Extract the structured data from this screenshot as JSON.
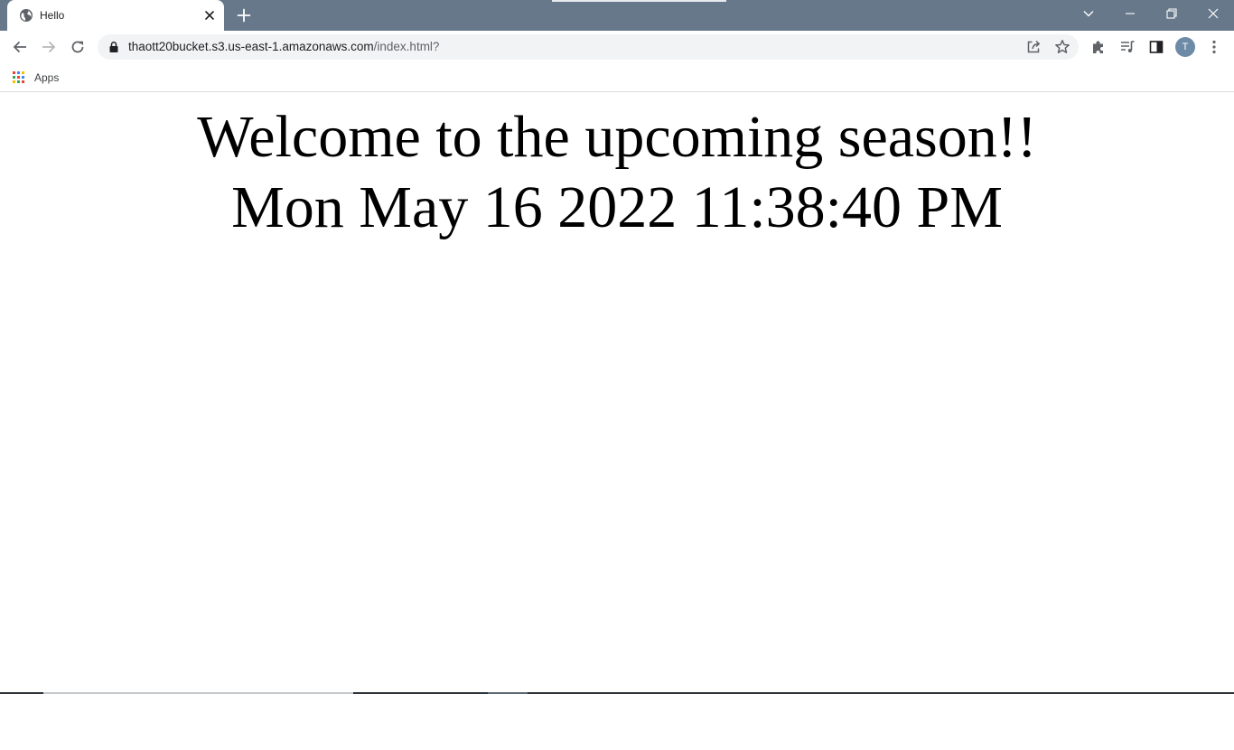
{
  "tab": {
    "title": "Hello",
    "favicon": "globe-icon",
    "close_icon": "close-icon"
  },
  "tabstrip": {
    "new_tab_icon": "plus-icon",
    "search_tabs_icon": "chevron-down-icon",
    "minimize_icon": "minimize-icon",
    "restore_icon": "restore-icon",
    "close_window_icon": "close-icon"
  },
  "toolbar": {
    "url_host": "thaott20bucket.s3.us-east-1.amazonaws.com",
    "url_path": "/index.html?",
    "lock_icon": "lock-icon",
    "share_icon": "share-icon",
    "bookmark_icon": "star-icon",
    "extensions_icon": "puzzle-icon",
    "media_icon": "queue-music-icon",
    "side_panel_icon": "side-panel-icon",
    "profile_initial": "T",
    "menu_icon": "kebab-menu-icon"
  },
  "bookmarks": {
    "apps_label": "Apps",
    "apps_icon": "apps-grid-icon"
  },
  "page": {
    "heading": "Welcome to the upcoming season!!",
    "datetime": "Mon May 16 2022 11:38:40 PM"
  },
  "colors": {
    "tabstrip": "#67788a",
    "omnibox": "#f1f3f4",
    "avatar": "#6d8aa6",
    "icon": "#5f6368"
  }
}
